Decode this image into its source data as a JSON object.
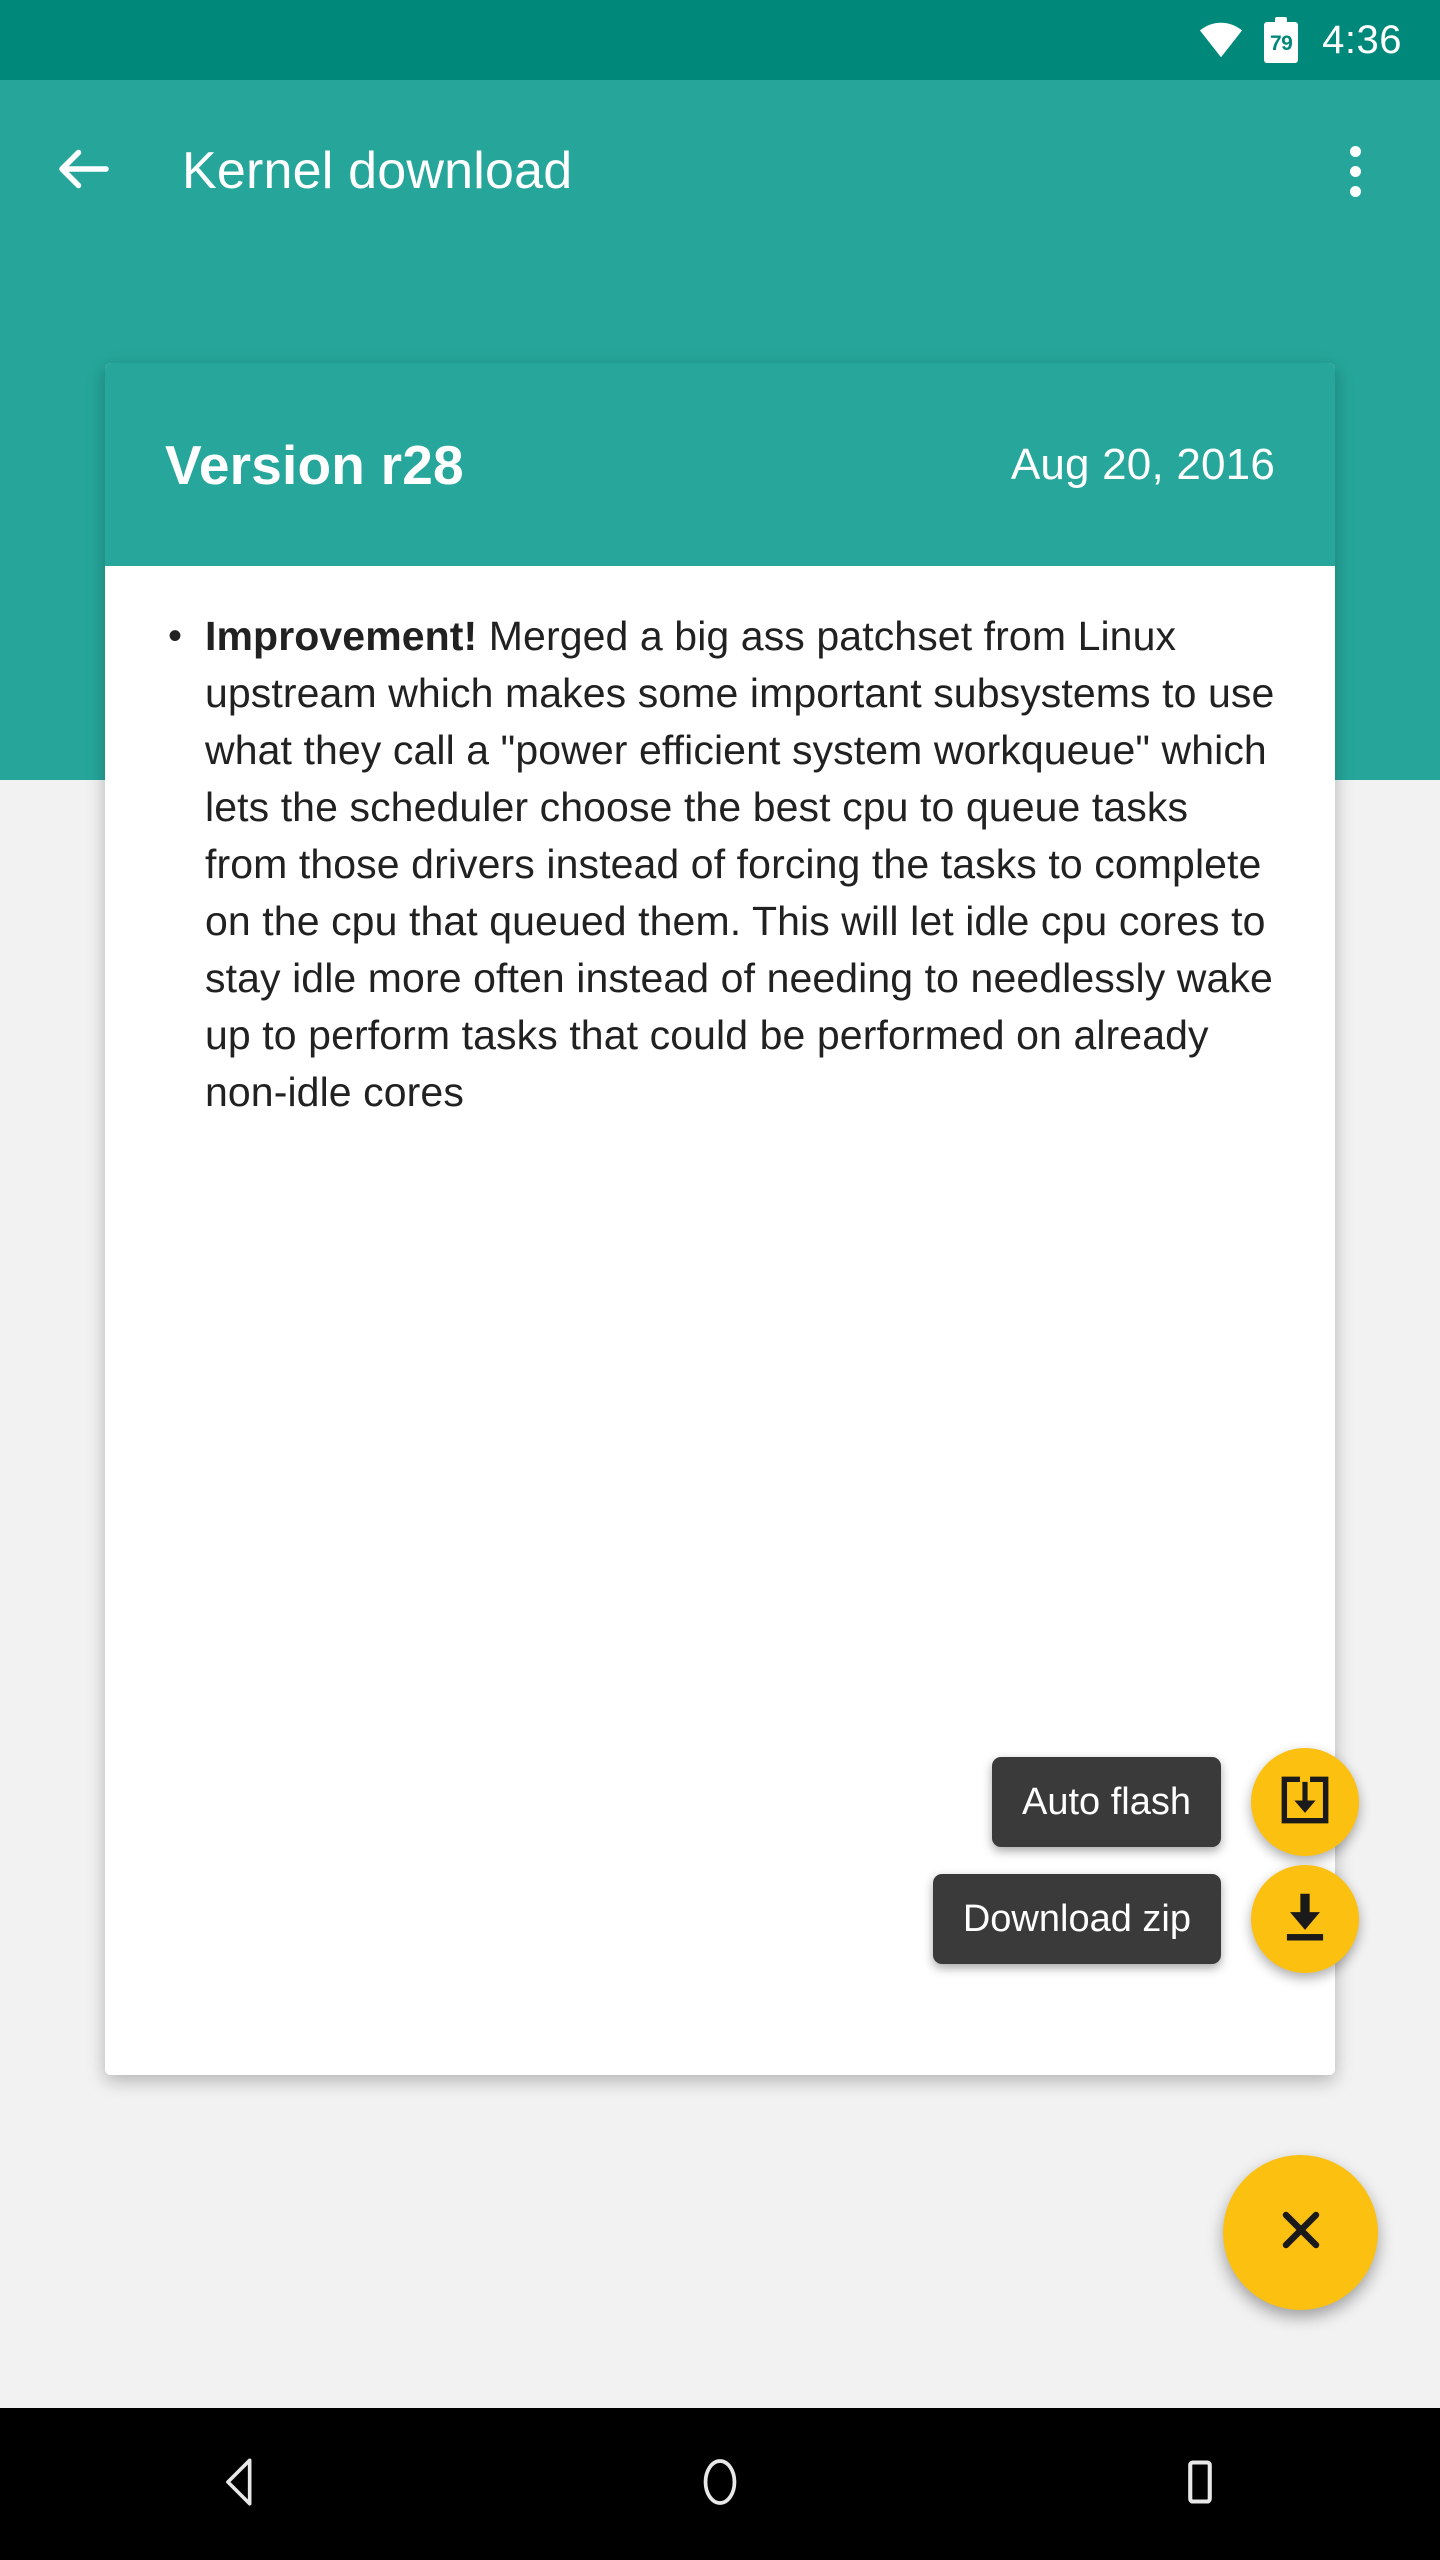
{
  "status_bar": {
    "wifi_icon": "wifi-icon",
    "battery_icon": "battery-icon",
    "battery_level": "79",
    "time": "4:36"
  },
  "app_bar": {
    "back_icon": "arrow-left-icon",
    "title": "Kernel download",
    "overflow_icon": "more-vertical-icon"
  },
  "card": {
    "version": "Version r28",
    "date": "Aug 20, 2016",
    "changelog": [
      {
        "bullet": "•",
        "label": "Improvement!",
        "text": " Merged a big ass patchset from Linux upstream which makes some important subsystems to use what they call a \"power efficient system workqueue\" which lets the scheduler choose the best cpu to queue tasks from those drivers instead of forcing the tasks to complete on the cpu that queued them. This will let idle cpu cores to stay idle more often instead of needing to needlessly wake up to perform tasks that could be performed on already non-idle cores"
      }
    ]
  },
  "fabs": {
    "auto_flash": {
      "label": "Auto flash",
      "icon": "system-update-icon"
    },
    "download_zip": {
      "label": "Download zip",
      "icon": "download-icon"
    },
    "main": {
      "icon": "close-icon"
    }
  },
  "nav_bar": {
    "back_icon": "nav-back-triangle-icon",
    "home_icon": "nav-home-circle-icon",
    "recents_icon": "nav-recents-square-icon"
  },
  "colors": {
    "status_bar": "#00897b",
    "app_bar": "#26a69a",
    "card_header": "#27a79b",
    "fab": "#fcc011",
    "label_bg": "#3a3a3a",
    "page_bg": "#f2f2f2"
  }
}
